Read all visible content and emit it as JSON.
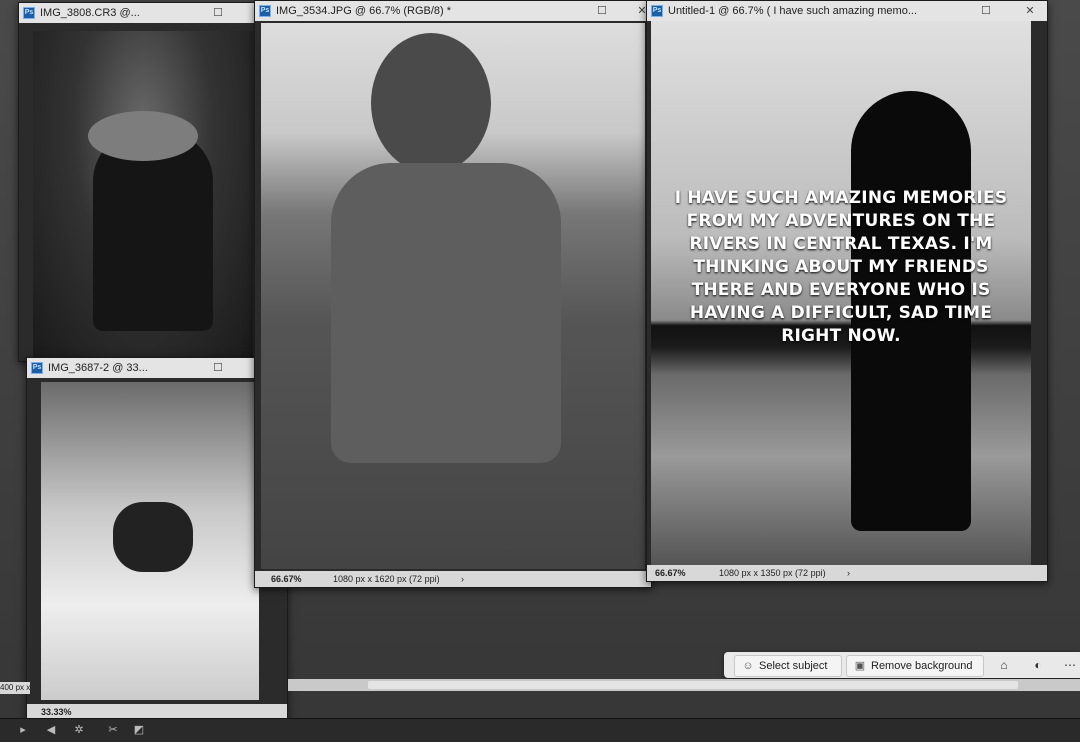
{
  "windows": {
    "w1": {
      "title": "IMG_3808.CR3 @..."
    },
    "w2": {
      "title": "IMG_3534.JPG @ 66.7% (RGB/8) *",
      "zoom": "66.67%",
      "dims": "1080 px x 1620 px (72 ppi)"
    },
    "w3": {
      "title": "Untitled-1 @ 66.7% ( I have such amazing memo...",
      "zoom": "66.67%",
      "dims": "1080 px x 1350 px (72 ppi)",
      "overlay_text": "I HAVE SUCH AMAZING MEMORIES FROM MY ADVENTURES ON THE RIVERS IN CENTRAL TEXAS. I'M THINKING ABOUT MY FRIENDS THERE AND EVERYONE WHO IS HAVING A DIFFICULT, SAD TIME RIGHT NOW."
    },
    "w4": {
      "title": "IMG_3687-2 @ 33...",
      "zoom": "33.33%"
    }
  },
  "icons": {
    "ps": "Ps",
    "minimize": "☐",
    "close": "✕",
    "chevron": "›"
  },
  "contextbar": {
    "select_subject": "Select subject",
    "remove_background": "Remove background"
  },
  "leftcut": "400 px x"
}
